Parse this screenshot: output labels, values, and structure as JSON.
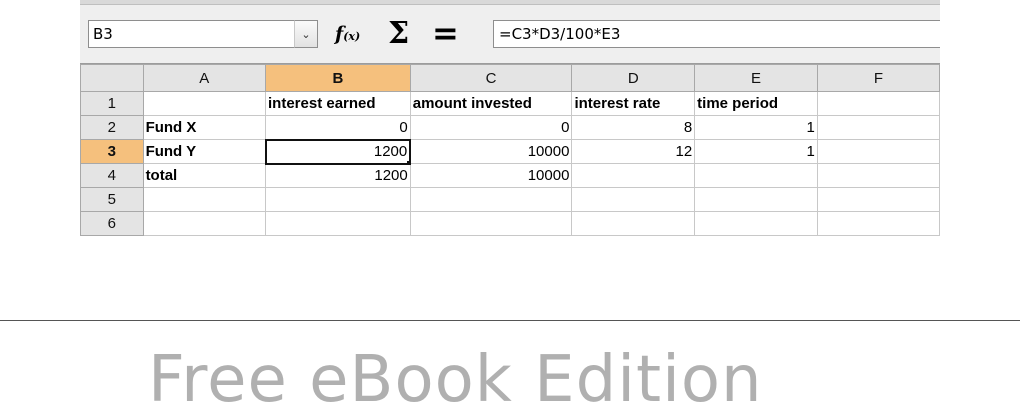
{
  "formula_bar": {
    "name_box": "B3",
    "dropdown_glyph": "⌄",
    "function_wizard_icon": "function-wizard-icon",
    "sum_icon": "sum-icon",
    "equals_icon": "equals-icon",
    "formula": "=C3*D3/100*E3"
  },
  "sheet": {
    "columns": [
      "A",
      "B",
      "C",
      "D",
      "E",
      "F"
    ],
    "selected_column": "B",
    "selected_row": "3",
    "active_cell": "B3",
    "rows": [
      {
        "label": "1",
        "cells": [
          "",
          "interest earned",
          "amount invested",
          "interest rate",
          "time period",
          ""
        ]
      },
      {
        "label": "2",
        "cells": [
          "Fund X",
          "0",
          "0",
          "8",
          "1",
          ""
        ]
      },
      {
        "label": "3",
        "cells": [
          "Fund Y",
          "1200",
          "10000",
          "12",
          "1",
          ""
        ]
      },
      {
        "label": "4",
        "cells": [
          "total",
          "1200",
          "10000",
          "",
          "",
          ""
        ]
      },
      {
        "label": "5",
        "cells": [
          "",
          "",
          "",
          "",
          "",
          ""
        ]
      },
      {
        "label": "6",
        "cells": [
          "",
          "",
          "",
          "",
          "",
          ""
        ]
      }
    ]
  },
  "watermark": "Free eBook Edition"
}
